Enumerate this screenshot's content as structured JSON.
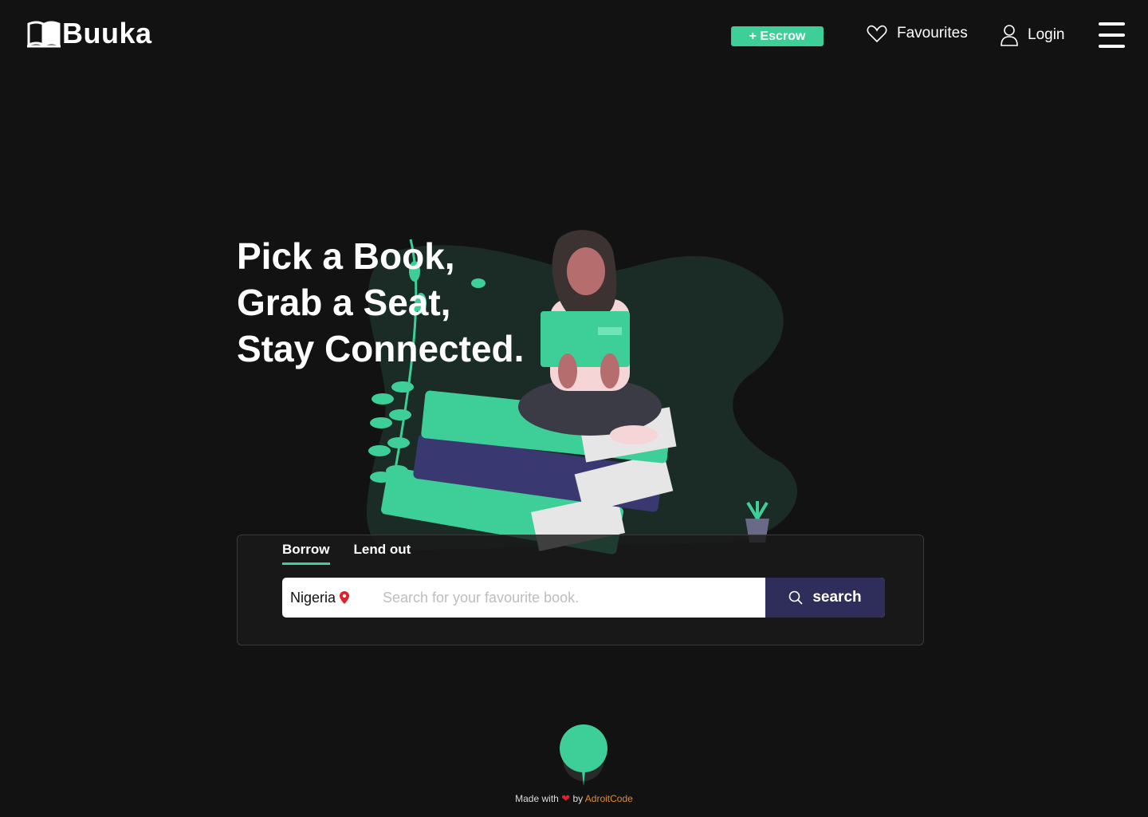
{
  "brand": {
    "name": "Buuka"
  },
  "header": {
    "escrow_label": "+ Escrow",
    "favourites_label": "Favourites",
    "login_label": "Login"
  },
  "hero": {
    "line1": "Pick a Book,",
    "line2": "Grab a Seat,",
    "line3": "Stay Connected."
  },
  "search": {
    "tabs": [
      {
        "label": "Borrow",
        "active": true
      },
      {
        "label": "Lend out",
        "active": false
      }
    ],
    "country": "Nigeria",
    "placeholder": "Search for your favourite book.",
    "button_label": "search"
  },
  "footer": {
    "made_with": "Made with",
    "heart": "❤",
    "by": "by",
    "author": "AdroitCode"
  },
  "colors": {
    "accent": "#3ecf98",
    "search_button": "#2f2e5a",
    "background": "#121212"
  }
}
